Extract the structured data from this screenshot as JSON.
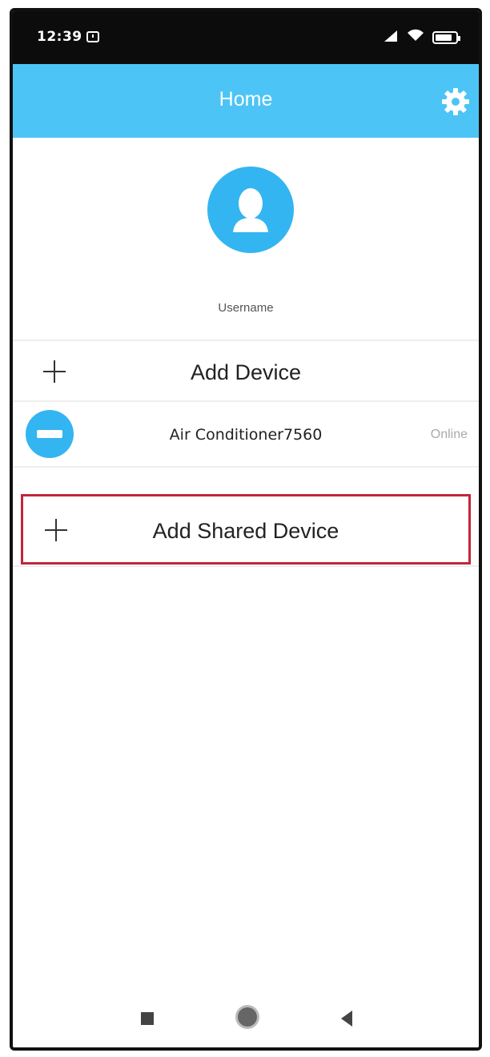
{
  "status_bar": {
    "time": "12:39",
    "alarm_icon": "alarm-clock-icon",
    "signal_icon": "cell-signal-icon",
    "wifi_icon": "wifi-icon",
    "battery_icon": "battery-icon"
  },
  "app_bar": {
    "title": "Home",
    "settings_icon": "gear-icon",
    "background_color": "#4dc4f6"
  },
  "profile": {
    "avatar_icon": "person-avatar-icon",
    "username": "Username"
  },
  "add_device": {
    "icon": "plus-icon",
    "label": "Add Device"
  },
  "devices": [
    {
      "icon": "air-conditioner-icon",
      "name": "Air Conditioner7560",
      "status": "Online"
    }
  ],
  "add_shared_device": {
    "icon": "plus-icon",
    "label": "Add Shared Device",
    "highlight_color": "#c2263a"
  },
  "nav_bar": {
    "recents_icon": "square-recents-icon",
    "home_icon": "circle-home-icon",
    "back_icon": "triangle-back-icon"
  }
}
